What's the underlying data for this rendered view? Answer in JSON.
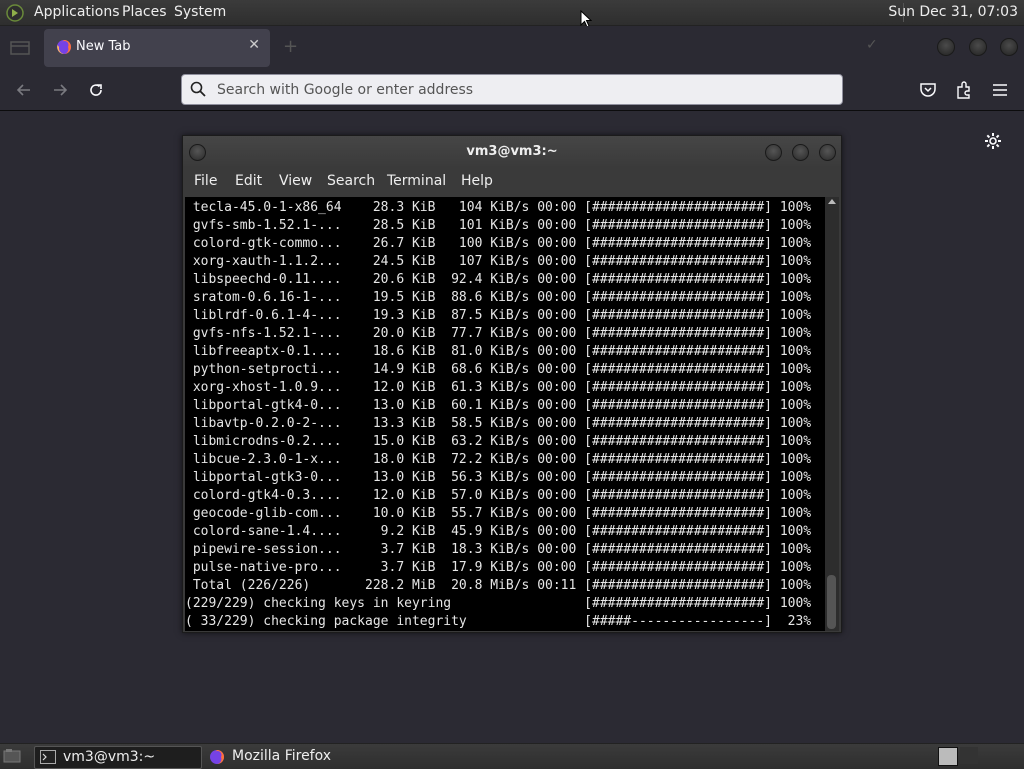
{
  "topbar": {
    "menus": [
      "Applications",
      "Places",
      "System"
    ],
    "clock": "Sun Dec 31, 07:03"
  },
  "browser": {
    "tab_title": "New Tab",
    "search_placeholder": "Search with Google or enter address"
  },
  "terminal": {
    "title": "vm3@vm3:~",
    "menu": [
      "File",
      "Edit",
      "View",
      "Search",
      "Terminal",
      "Help"
    ],
    "lines": [
      " tecla-45.0-1-x86_64    28.3 KiB   104 KiB/s 00:00 [######################] 100%",
      " gvfs-smb-1.52.1-...    28.5 KiB   101 KiB/s 00:00 [######################] 100%",
      " colord-gtk-commo...    26.7 KiB   100 KiB/s 00:00 [######################] 100%",
      " xorg-xauth-1.1.2...    24.5 KiB   107 KiB/s 00:00 [######################] 100%",
      " libspeechd-0.11....    20.6 KiB  92.4 KiB/s 00:00 [######################] 100%",
      " sratom-0.6.16-1-...    19.5 KiB  88.6 KiB/s 00:00 [######################] 100%",
      " liblrdf-0.6.1-4-...    19.3 KiB  87.5 KiB/s 00:00 [######################] 100%",
      " gvfs-nfs-1.52.1-...    20.0 KiB  77.7 KiB/s 00:00 [######################] 100%",
      " libfreeaptx-0.1....    18.6 KiB  81.0 KiB/s 00:00 [######################] 100%",
      " python-setprocti...    14.9 KiB  68.6 KiB/s 00:00 [######################] 100%",
      " xorg-xhost-1.0.9...    12.0 KiB  61.3 KiB/s 00:00 [######################] 100%",
      " libportal-gtk4-0...    13.0 KiB  60.1 KiB/s 00:00 [######################] 100%",
      " libavtp-0.2.0-2-...    13.3 KiB  58.5 KiB/s 00:00 [######################] 100%",
      " libmicrodns-0.2....    15.0 KiB  63.2 KiB/s 00:00 [######################] 100%",
      " libcue-2.3.0-1-x...    18.0 KiB  72.2 KiB/s 00:00 [######################] 100%",
      " libportal-gtk3-0...    13.0 KiB  56.3 KiB/s 00:00 [######################] 100%",
      " colord-gtk4-0.3....    12.0 KiB  57.0 KiB/s 00:00 [######################] 100%",
      " geocode-glib-com...    10.0 KiB  55.7 KiB/s 00:00 [######################] 100%",
      " colord-sane-1.4....     9.2 KiB  45.9 KiB/s 00:00 [######################] 100%",
      " pipewire-session...     3.7 KiB  18.3 KiB/s 00:00 [######################] 100%",
      " pulse-native-pro...     3.7 KiB  17.9 KiB/s 00:00 [######################] 100%",
      " Total (226/226)       228.2 MiB  20.8 MiB/s 00:11 [######################] 100%",
      "(229/229) checking keys in keyring                 [######################] 100%",
      "( 33/229) checking package integrity               [#####-----------------]  23%"
    ]
  },
  "taskbar": {
    "tasks": [
      "vm3@vm3:~",
      "Mozilla Firefox"
    ]
  }
}
